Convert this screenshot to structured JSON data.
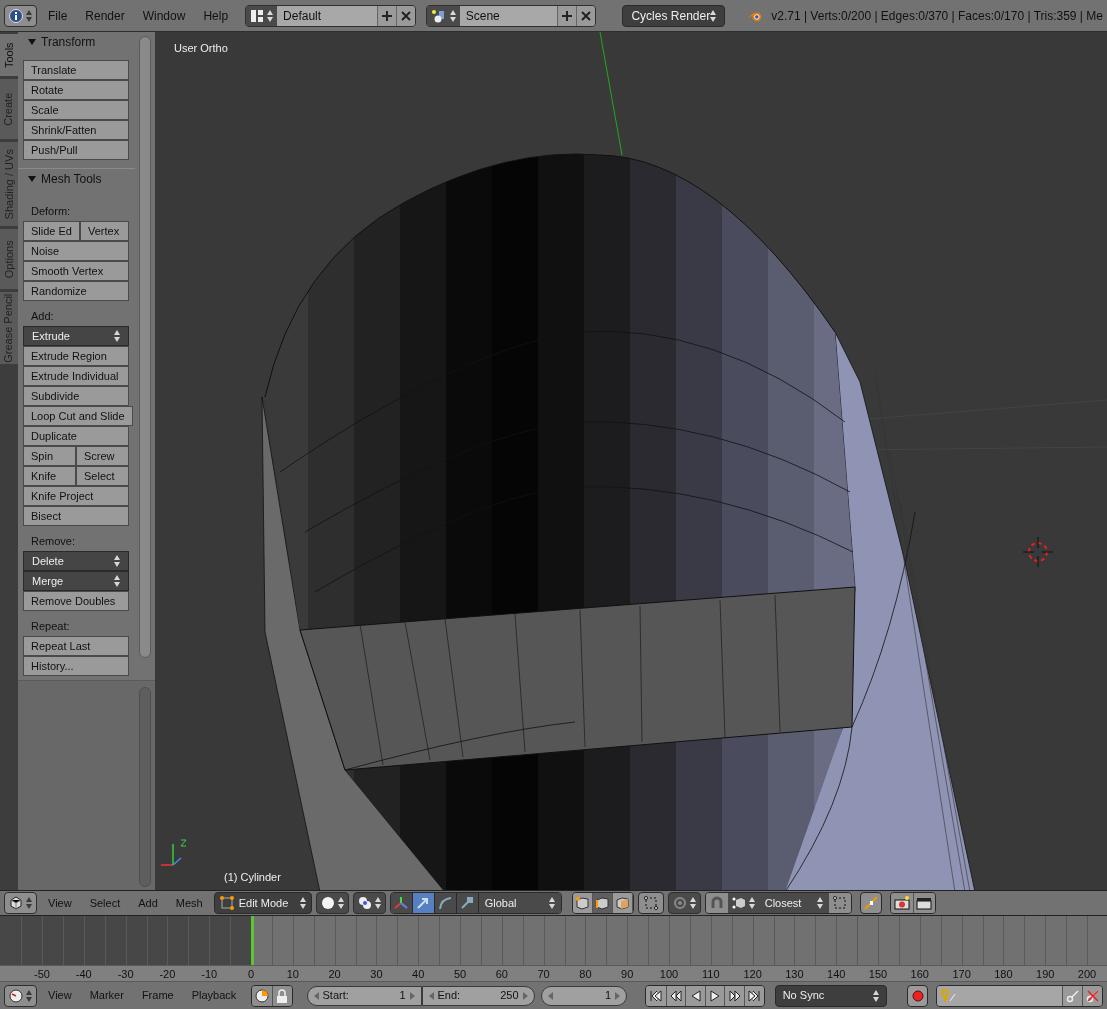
{
  "top_bar": {
    "menus": [
      "File",
      "Render",
      "Window",
      "Help"
    ],
    "screen_layout": "Default",
    "scene": "Scene",
    "render_engine": "Cycles Render",
    "stats": "v2.71 | Verts:0/200 | Edges:0/370 | Faces:0/170 | Tris:359 | Me"
  },
  "tool_tabs": [
    {
      "label": "Tools",
      "selected": true
    },
    {
      "label": "Create",
      "selected": false
    },
    {
      "label": "Shading / UVs",
      "selected": false
    },
    {
      "label": "Options",
      "selected": false
    },
    {
      "label": "Grease Pencil",
      "selected": false
    }
  ],
  "panels": [
    {
      "title": "Transform",
      "expanded": true,
      "items": [
        {
          "kind": "button",
          "labels": [
            "Translate"
          ]
        },
        {
          "kind": "button",
          "labels": [
            "Rotate"
          ]
        },
        {
          "kind": "button",
          "labels": [
            "Scale"
          ]
        },
        {
          "kind": "button",
          "labels": [
            "Shrink/Fatten"
          ]
        },
        {
          "kind": "button",
          "labels": [
            "Push/Pull"
          ]
        }
      ]
    },
    {
      "title": "Mesh Tools",
      "expanded": true,
      "items": [
        {
          "kind": "label",
          "labels": [
            "Deform:"
          ]
        },
        {
          "kind": "button",
          "labels": [
            "Slide Ed",
            "Vertex"
          ]
        },
        {
          "kind": "button",
          "labels": [
            "Noise"
          ]
        },
        {
          "kind": "button",
          "labels": [
            "Smooth Vertex"
          ]
        },
        {
          "kind": "button",
          "labels": [
            "Randomize"
          ]
        },
        {
          "kind": "label",
          "labels": [
            "Add:"
          ]
        },
        {
          "kind": "menu",
          "labels": [
            "Extrude"
          ]
        },
        {
          "kind": "button",
          "labels": [
            "Extrude Region"
          ]
        },
        {
          "kind": "button",
          "labels": [
            "Extrude Individual"
          ]
        },
        {
          "kind": "button",
          "labels": [
            "Subdivide"
          ]
        },
        {
          "kind": "button",
          "labels": [
            "Loop Cut and Slide"
          ]
        },
        {
          "kind": "button",
          "labels": [
            "Duplicate"
          ]
        },
        {
          "kind": "button",
          "labels": [
            "Spin",
            "Screw"
          ]
        },
        {
          "kind": "button",
          "labels": [
            "Knife",
            "Select"
          ]
        },
        {
          "kind": "button",
          "labels": [
            "Knife Project"
          ]
        },
        {
          "kind": "button",
          "labels": [
            "Bisect"
          ]
        },
        {
          "kind": "label",
          "labels": [
            "Remove:"
          ]
        },
        {
          "kind": "menu",
          "labels": [
            "Delete"
          ]
        },
        {
          "kind": "menu",
          "labels": [
            "Merge"
          ]
        },
        {
          "kind": "button",
          "labels": [
            "Remove Doubles"
          ]
        },
        {
          "kind": "label",
          "labels": [
            "Repeat:"
          ]
        },
        {
          "kind": "button",
          "labels": [
            "Repeat Last"
          ]
        },
        {
          "kind": "button",
          "labels": [
            "History..."
          ]
        }
      ]
    }
  ],
  "viewport": {
    "view_label": "User Ortho",
    "object_label": "(1) Cylinder"
  },
  "viewport_header": {
    "menus": [
      "View",
      "Select",
      "Add",
      "Mesh"
    ],
    "mode": "Edit Mode",
    "manipulators": [
      {
        "kind": "axes",
        "selected": false
      },
      {
        "kind": "translate",
        "selected": true
      },
      {
        "kind": "rotate",
        "selected": false
      },
      {
        "kind": "scale",
        "selected": false
      }
    ],
    "orientation": "Global",
    "select_modes": [
      {
        "kind": "vertex",
        "selected": false
      },
      {
        "kind": "edge",
        "selected": true
      },
      {
        "kind": "face",
        "selected": false
      }
    ],
    "snap_target": "Closest"
  },
  "timeline": {
    "ticks": [
      "-50",
      "-40",
      "-30",
      "-20",
      "-10",
      "0",
      "10",
      "20",
      "30",
      "40",
      "50",
      "60",
      "70",
      "80",
      "90",
      "100",
      "110",
      "120",
      "130",
      "140",
      "150",
      "160",
      "170",
      "180",
      "190",
      "200"
    ]
  },
  "timeline_header": {
    "menus": [
      "View",
      "Marker",
      "Frame",
      "Playback"
    ],
    "start_label": "Start:",
    "start": "1",
    "end_label": "End:",
    "end": "250",
    "current_frame": "1",
    "sync": "No Sync"
  }
}
